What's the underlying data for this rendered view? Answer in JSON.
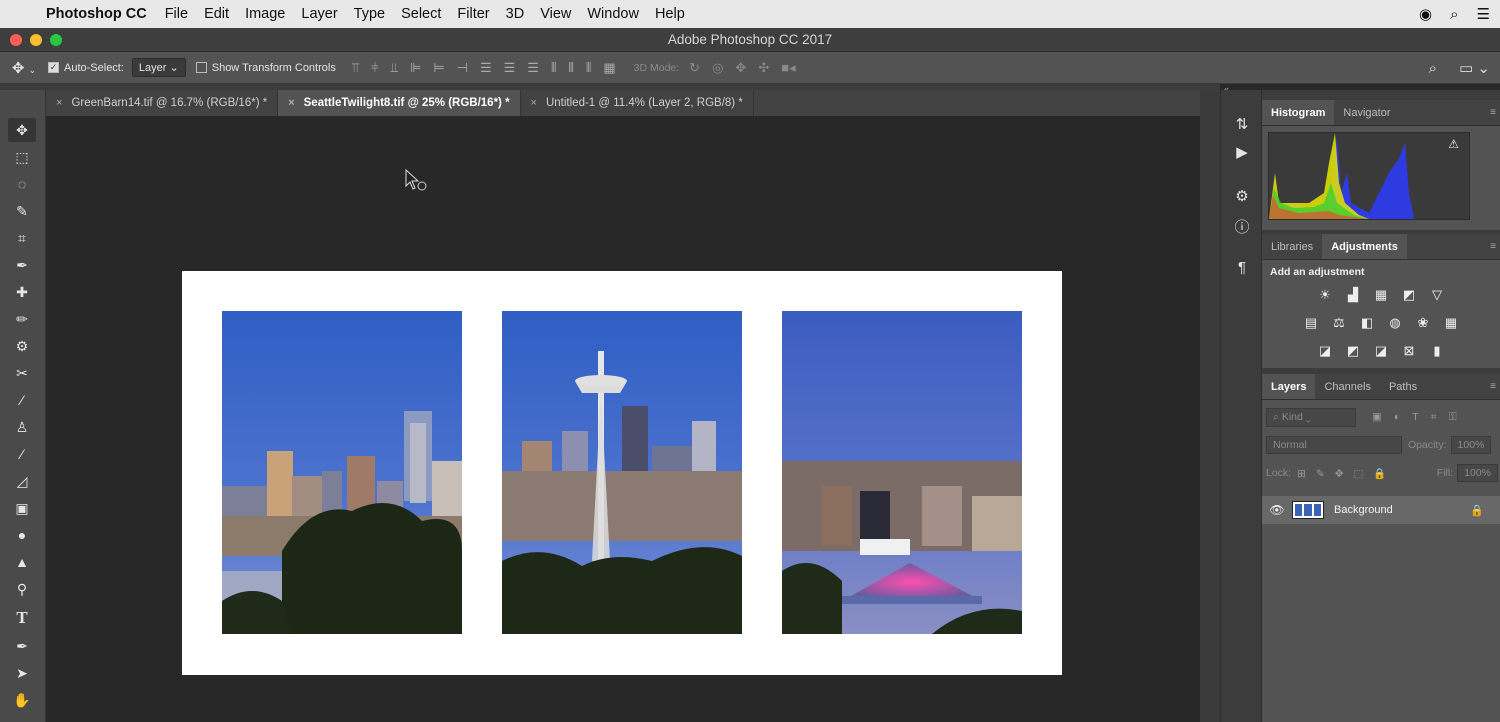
{
  "menubar": {
    "apple_icon": "apple-logo",
    "app_name": "Photoshop CC",
    "items": [
      "File",
      "Edit",
      "Image",
      "Layer",
      "Type",
      "Select",
      "Filter",
      "3D",
      "View",
      "Window",
      "Help"
    ]
  },
  "window": {
    "title": "Adobe Photoshop CC 2017"
  },
  "options": {
    "auto_select_label": "Auto-Select:",
    "auto_select_checked": true,
    "auto_select_value": "Layer",
    "transform_label": "Show Transform Controls",
    "transform_checked": false,
    "mode_3d_label": "3D Mode:"
  },
  "tabs": [
    {
      "label": "GreenBarn14.tif @ 16.7% (RGB/16*) *",
      "active": false
    },
    {
      "label": "SeattleTwilight8.tif @ 25% (RGB/16*) *",
      "active": true
    },
    {
      "label": "Untitled-1 @ 11.4% (Layer 2, RGB/8) *",
      "active": false
    }
  ],
  "tools": [
    "move-icon",
    "marquee-icon",
    "lasso-icon",
    "quick-select-icon",
    "crop-icon",
    "eyedropper-icon",
    "healing-icon",
    "brush-icon",
    "clone-stamp-icon",
    "history-brush-icon",
    "eraser-icon",
    "gradient-icon",
    "blur-icon",
    "dodge-icon",
    "pen-icon",
    "type-icon",
    "path-select-icon",
    "shape-icon",
    "hand-icon"
  ],
  "panels": {
    "histogram": {
      "tabs": [
        "Histogram",
        "Navigator"
      ],
      "active": "Histogram",
      "warning_icon": "warning-icon"
    },
    "adjustments": {
      "tabs": [
        "Libraries",
        "Adjustments"
      ],
      "active": "Adjustments",
      "title": "Add an adjustment"
    },
    "layers": {
      "tabs": [
        "Layers",
        "Channels",
        "Paths"
      ],
      "active": "Layers",
      "kind_placeholder": "Kind",
      "blend_mode": "Normal",
      "opacity_label": "Opacity:",
      "opacity_value": "100%",
      "lock_label": "Lock:",
      "fill_label": "Fill:",
      "fill_value": "100%",
      "layer_name": "Background"
    }
  },
  "colors": {
    "accent_red": "#ff5f57",
    "accent_yellow": "#febc2e",
    "accent_green": "#28c840",
    "sky_blue": "#3f63c0"
  }
}
